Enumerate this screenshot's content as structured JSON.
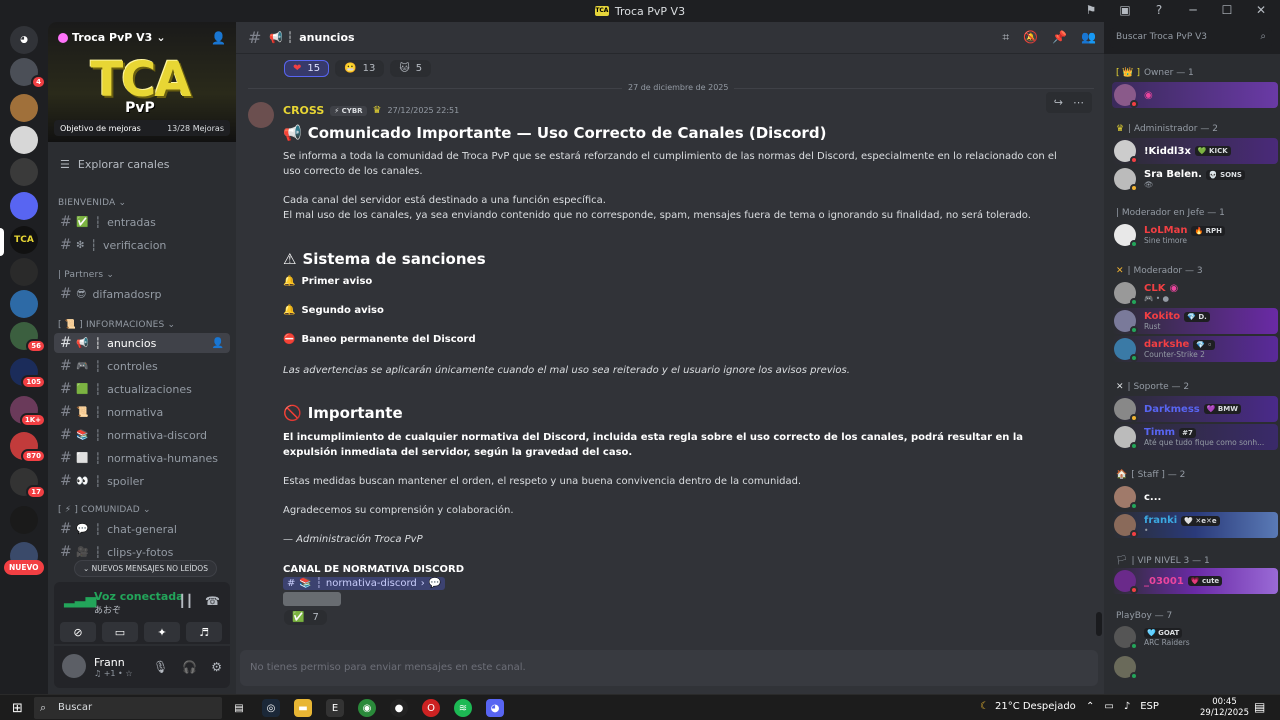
{
  "window": {
    "title": "Troca PvP V3"
  },
  "server": {
    "name": "Troca PvP V3",
    "banner_big": "TCA",
    "banner_small": "PvP",
    "boost_goal": "Objetivo de mejoras",
    "boost_count": "13/28 Mejoras"
  },
  "rail": {
    "badges": [
      "4",
      "56",
      "105",
      "1K+",
      "870",
      "17"
    ],
    "new_label": "NUEVO"
  },
  "sidebar": {
    "browse": "Explorar canales",
    "categories": {
      "bienvenida": "BIENVENIDA",
      "partners": "| Partners",
      "informaciones": "[ 📜 ] INFORMACIONES",
      "comunidad": "[ ⚡ ] COMUNIDAD"
    },
    "channels": [
      {
        "name": "entradas",
        "emoji": "✅"
      },
      {
        "name": "verificacion",
        "emoji": "❇"
      },
      {
        "name": "difamadosrp",
        "emoji": "😎"
      },
      {
        "name": "anuncios",
        "emoji": "📢"
      },
      {
        "name": "controles",
        "emoji": "🎮"
      },
      {
        "name": "actualizaciones",
        "emoji": "🟩"
      },
      {
        "name": "normativa",
        "emoji": "📜"
      },
      {
        "name": "normativa-discord",
        "emoji": "📚"
      },
      {
        "name": "normativa-humanes",
        "emoji": "⬜"
      },
      {
        "name": "spoiler",
        "emoji": "👀"
      },
      {
        "name": "chat-general",
        "emoji": "💬"
      },
      {
        "name": "clips-y-fotos",
        "emoji": "🎥"
      }
    ],
    "new_unread": "NUEVOS MENSAJES NO LEÍDOS"
  },
  "voice": {
    "title": "Voz conectada",
    "sub": "あおぞ"
  },
  "user": {
    "name": "Frann",
    "status": "♫ +1 • ☆"
  },
  "channel_header": {
    "name": "anuncios"
  },
  "search": {
    "placeholder": "Buscar Troca PvP V3"
  },
  "reactions_top": [
    {
      "emoji": "❤",
      "count": "15"
    },
    {
      "emoji": "😬",
      "count": "13"
    },
    {
      "emoji": "🐱",
      "count": "5"
    }
  ],
  "date_divider": "27 de diciembre de 2025",
  "message": {
    "author": "CROSS",
    "tag": "CYBR",
    "timestamp": "27/12/2025 22:51",
    "title": "Comunicado Importante — Uso Correcto de Canales (Discord)",
    "p1": "Se informa a toda la comunidad de Troca PvP que se estará reforzando el cumplimiento de las normas del Discord, especialmente en lo relacionado con el uso correcto de los canales.",
    "p2a": "Cada canal del servidor está destinado a una función específica.",
    "p2b": "El mal uso de los canales, ya sea enviando contenido que no corresponde, spam, mensajes fuera de tema o ignorando su finalidad, no será tolerado.",
    "h_sanciones": "Sistema de sanciones",
    "s1": "Primer aviso",
    "s2": "Segundo aviso",
    "s3": "Baneo permanente del Discord",
    "note": "Las advertencias se aplicarán únicamente cuando el mal uso sea reiterado y el usuario ignore los avisos previos.",
    "h_importante": "Importante",
    "imp": "El incumplimiento de cualquier normativa del Discord, incluida esta regla sobre el uso correcto de los canales, podrá resultar en la expulsión inmediata del servidor, según la gravedad del caso.",
    "p3": "Estas medidas buscan mantener el orden, el respeto y una buena convivencia dentro de la comunidad.",
    "p4": "Agradecemos su comprensión y colaboración.",
    "sign": "— Administración Troca PvP",
    "canal_label": "CANAL DE NORMATIVA DISCORD",
    "mention": "normativa-discord",
    "reaction": {
      "emoji": "✅",
      "count": "7"
    }
  },
  "composer": {
    "placeholder": "No tienes permiso para enviar mensajes en este canal."
  },
  "members": {
    "groups": [
      {
        "label": "Owner — 1"
      },
      {
        "label": "| Administrador — 2"
      },
      {
        "label": "| Moderador en Jefe — 1"
      },
      {
        "label": "| Moderador — 3"
      },
      {
        "label": "| Soporte — 2"
      },
      {
        "label": "[ Staff ] — 2"
      },
      {
        "label": "| VIP NIVEL 3 — 1"
      },
      {
        "label": "PlayBoy — 7"
      }
    ],
    "list": [
      {
        "name": "!Kiddl3x",
        "tag": "KICK",
        "sub": "",
        "color": "#ffffff"
      },
      {
        "name": "Sra Belen.",
        "tag": "SONS",
        "sub": "",
        "color": "#ffffff"
      },
      {
        "name": "LoLMan",
        "tag": "RPH",
        "sub": "Sine timore",
        "color": "#f23f43"
      },
      {
        "name": "CLK",
        "tag": "",
        "sub": "",
        "color": "#f23f43"
      },
      {
        "name": "Kokito",
        "tag": "",
        "sub": "Rust",
        "color": "#f23f43"
      },
      {
        "name": "darkshe",
        "tag": "",
        "sub": "Counter-Strike 2",
        "color": "#f23f43"
      },
      {
        "name": "Darkmess",
        "tag": "BMW",
        "sub": "",
        "color": "#5865f2"
      },
      {
        "name": "Timm",
        "tag": "#7",
        "sub": "Até que tudo fique como sonh...",
        "color": "#5865f2"
      },
      {
        "name": "c...",
        "tag": "",
        "sub": "",
        "color": "#ffffff"
      },
      {
        "name": "franki",
        "tag": "",
        "sub": "",
        "color": "#3ba8e0"
      },
      {
        "name": "_03001",
        "tag": "cute",
        "sub": "",
        "color": "#eb459e"
      },
      {
        "name": "",
        "tag": "GOAT",
        "sub": "ARC Raiders",
        "color": "#ffffff"
      }
    ]
  },
  "taskbar": {
    "search": "Buscar",
    "weather": "21°C  Despejado",
    "lang": "ESP",
    "time": "00:45",
    "date": "29/12/2025"
  }
}
